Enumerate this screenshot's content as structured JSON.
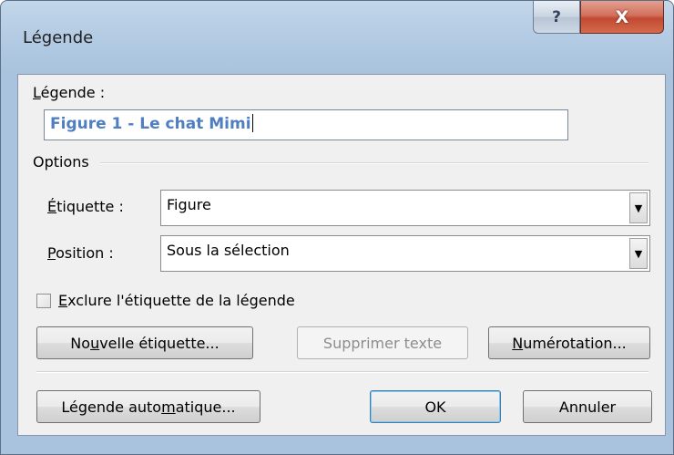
{
  "window": {
    "title": "Légende",
    "help_glyph": "?",
    "close_glyph": "X"
  },
  "caption": {
    "label": "Légende :",
    "label_mnemonic": "L",
    "label_rest": "égende :",
    "value": "Figure 1 - Le chat Mimi"
  },
  "options": {
    "group_label": "Options",
    "label_field": {
      "label_mnemonic": "É",
      "label_rest": "tiquette :",
      "value": "Figure"
    },
    "position_field": {
      "label_mnemonic": "P",
      "label_rest": "osition :",
      "value": "Sous la sélection"
    }
  },
  "exclude_checkbox": {
    "label_mnemonic": "E",
    "label_rest": "xclure l'étiquette de la légende",
    "checked": false
  },
  "buttons": {
    "new_label": {
      "pre": "No",
      "mnemonic": "u",
      "post": "velle étiquette..."
    },
    "delete_label": {
      "label": "Supprimer texte",
      "enabled": false
    },
    "numbering": {
      "pre": "",
      "mnemonic": "N",
      "post": "umérotation..."
    },
    "autocaption": {
      "pre": "Légende auto",
      "mnemonic": "m",
      "post": "atique..."
    },
    "ok": {
      "label": "OK"
    },
    "cancel": {
      "label": "Annuler"
    }
  },
  "icons": {
    "help": "help-icon",
    "close": "close-icon",
    "dropdown": "chevron-down-icon"
  },
  "colors": {
    "caption_text": "#4f7fc1",
    "close_button": "#c24a32",
    "frame": "#b3cbe3"
  }
}
